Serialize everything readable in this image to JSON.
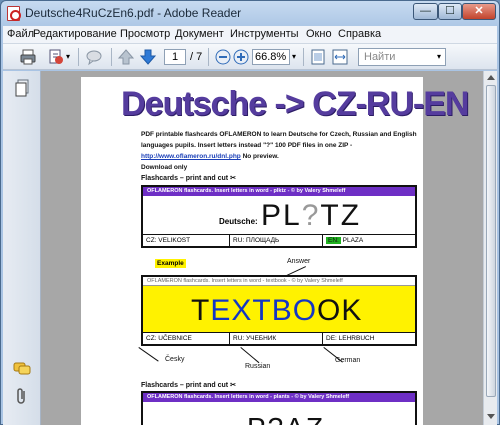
{
  "window": {
    "title": "Deutsche4RuCzEn6.pdf - Adobe Reader",
    "buttons": {
      "minimize": "—",
      "maximize": "☐",
      "close": "✕"
    }
  },
  "menu": [
    "Файл",
    "Редактирование",
    "Просмотр",
    "Документ",
    "Инструменты",
    "Окно",
    "Справка"
  ],
  "toolbar": {
    "icons": [
      "print-icon",
      "share-icon",
      "comment-icon",
      "page-up-icon",
      "page-down-icon",
      "zoom-out-icon",
      "zoom-in-icon",
      "fit-page-icon",
      "fit-width-icon"
    ],
    "page_current": "1",
    "page_total": "/ 7",
    "zoom": "66.8%",
    "search_placeholder": "Найти"
  },
  "navpane": {
    "icons": [
      "pages-icon",
      "comments-icon",
      "attachments-icon"
    ]
  },
  "document": {
    "heading_part1": "Deutsche ->",
    "heading_part2": "CZ-RU-EN",
    "intro_line1": "PDF printable flashcards OFLAMERON to learn Deutsche for Czech, Russian and English languages pupils. Insert letters instead \"?\"",
    "intro_line2": " 100 PDF files in one ZIP - ",
    "intro_link": "http://www.oflameron.ru/dnl.php",
    "intro_line3": " No preview.",
    "intro_line4": "Download only",
    "cut_label": "Flashcards – print and cut ✂",
    "card1": {
      "header": "OFLAMERON flashcards. Insert letters in word - plktz - © by Valery Shmeleff",
      "small_word": "Deutsche:",
      "big_word_a": "PL",
      "big_word_q": "?",
      "big_word_b": "TZ",
      "cz": "CZ:  VELIKOST",
      "ru": "RU:  ПЛОЩАДЬ",
      "en_label": "EN:",
      "en_value": " PLAZA"
    },
    "example_label": "Example",
    "answer_label": "Answer",
    "card2": {
      "header": "OFLAMERON flashcards. Insert letters in word - textbook - © by Valery Shmeleff",
      "word_parts": [
        {
          "text": "T",
          "style": "dark"
        },
        {
          "text": "EXT",
          "style": "blue"
        },
        {
          "text": "BO",
          "style": "blue"
        },
        {
          "text": "OK",
          "style": "dark"
        }
      ],
      "cz": "CZ:  UČEBNICE",
      "ru": "RU:  УЧЕБНИК",
      "de": "DE:  LEHRBUCH"
    },
    "annotations": {
      "cesky": "Česky",
      "russian": "Russian",
      "german": "German"
    },
    "cut_label2": "Flashcards – print and cut ✂",
    "card3": {
      "header": "OFLAMERON flashcards. Insert letters in word - plants - © by Valery Shmeleff",
      "partial_word": "P?AZ"
    }
  }
}
